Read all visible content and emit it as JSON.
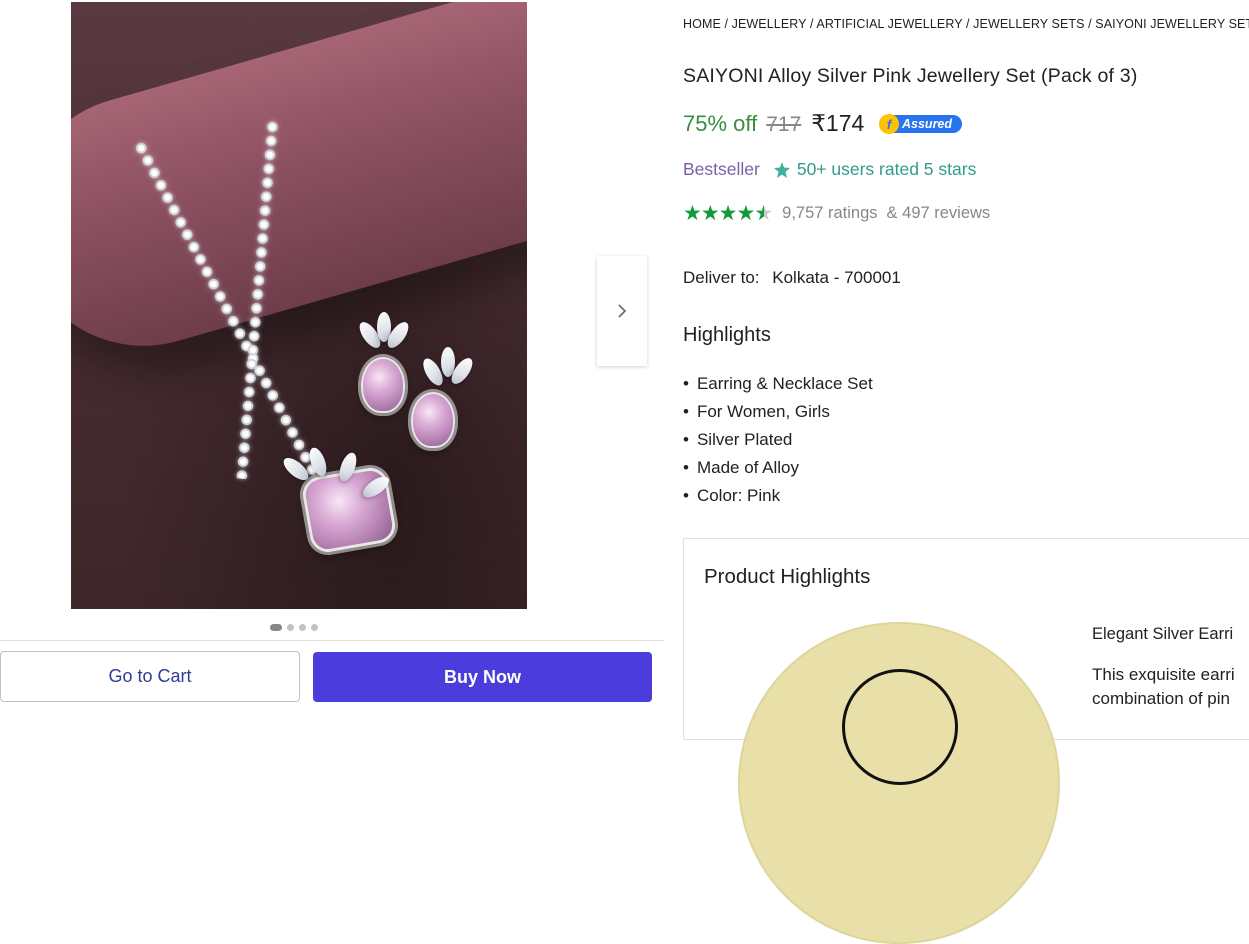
{
  "breadcrumb": "HOME / JEWELLERY / ARTIFICIAL JEWELLERY / JEWELLERY SETS / SAIYONI JEWELLERY SETS",
  "product": {
    "title": "SAIYONI Alloy Silver Pink Jewellery Set (Pack of 3)",
    "discount": "75% off",
    "mrp": "717",
    "price": "₹174",
    "assured_label": "Assured",
    "assured_mark": "f",
    "bestseller": "Bestseller",
    "users_rated": "50+ users rated 5 stars",
    "rating_value": 4.4,
    "ratings_text": "9,757 ratings",
    "reviews_text": "& 497 reviews"
  },
  "delivery": {
    "label": "Deliver to:",
    "location": "Kolkata - 700001"
  },
  "highlights": {
    "title": "Highlights",
    "items": [
      "Earring & Necklace Set",
      "For Women, Girls",
      "Silver Plated",
      "Made of Alloy",
      "Color: Pink"
    ]
  },
  "product_highlights": {
    "title": "Product Highlights",
    "subtitle": "Elegant Silver Earri",
    "desc_line1": "This exquisite earri",
    "desc_line2": "combination of pin"
  },
  "carousel": {
    "total": 4,
    "active": 1
  },
  "actions": {
    "cart_label": "Go to Cart",
    "buy_label": "Buy Now"
  },
  "colors": {
    "brand_blue": "#2874f0",
    "buy_button": "#4b3ddc",
    "discount_green": "#388e3c",
    "star_green": "#119a38",
    "bestseller_purple": "#7b5fa8",
    "users_rated_teal": "#2e9c8b"
  },
  "icons": {
    "next": "chevron-right-icon",
    "users_rated": "sparkle-star-icon",
    "rating": "star-icon"
  }
}
